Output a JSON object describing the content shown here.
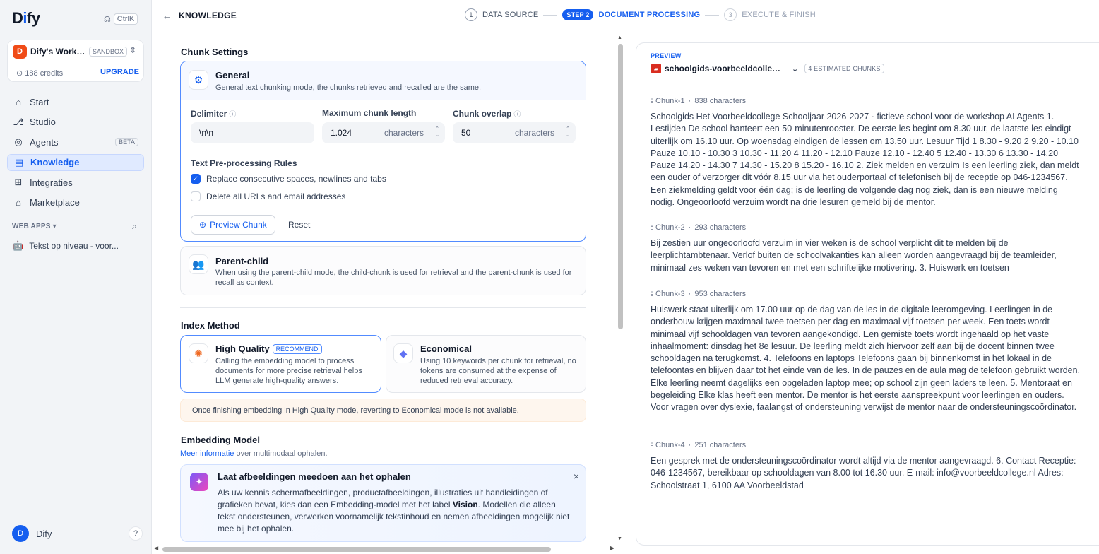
{
  "sidebar": {
    "logo": "Dify",
    "shortcut": "CtrlK",
    "workspace": {
      "avatar": "D",
      "name": "Dify's Works...",
      "badge": "SANDBOX",
      "credits": "188 credits",
      "upgrade": "UPGRADE"
    },
    "nav": [
      {
        "label": "Start",
        "icon": "home-icon"
      },
      {
        "label": "Studio",
        "icon": "studio-icon"
      },
      {
        "label": "Agents",
        "icon": "agents-icon",
        "badge": "BETA"
      },
      {
        "label": "Knowledge",
        "icon": "knowledge-icon",
        "active": true
      },
      {
        "label": "Integraties",
        "icon": "integrations-icon"
      },
      {
        "label": "Marketplace",
        "icon": "marketplace-icon"
      }
    ],
    "web_apps_label": "WEB APPS",
    "app_item": {
      "emoji": "🤖",
      "label": "Tekst op niveau - voor..."
    },
    "user": {
      "avatar": "D",
      "name": "Dify"
    },
    "help": "?"
  },
  "topbar": {
    "title": "KNOWLEDGE",
    "steps": [
      {
        "num": "1",
        "label": "DATA SOURCE",
        "state": "done"
      },
      {
        "num": "STEP 2",
        "label": "DOCUMENT PROCESSING",
        "state": "active"
      },
      {
        "num": "3",
        "label": "EXECUTE & FINISH",
        "state": "disabled"
      }
    ]
  },
  "chunk_settings": {
    "title": "Chunk Settings",
    "general": {
      "title": "General",
      "desc": "General text chunking mode, the chunks retrieved and recalled are the same.",
      "delimiter_label": "Delimiter",
      "delimiter_value": "\\n\\n",
      "max_len_label": "Maximum chunk length",
      "max_len_value": "1.024",
      "overlap_label": "Chunk overlap",
      "overlap_value": "50",
      "unit": "characters",
      "rules_title": "Text Pre-processing Rules",
      "rule1": "Replace consecutive spaces, newlines and tabs",
      "rule2": "Delete all URLs and email addresses",
      "preview_btn": "Preview Chunk",
      "reset_btn": "Reset"
    },
    "parent_child": {
      "title": "Parent-child",
      "desc": "When using the parent-child mode, the child-chunk is used for retrieval and the parent-chunk is used for recall as context."
    }
  },
  "index_method": {
    "title": "Index Method",
    "hq_title": "High Quality",
    "hq_badge": "RECOMMEND",
    "hq_desc": "Calling the embedding model to process documents for more precise retrieval helps LLM generate high-quality answers.",
    "eco_title": "Economical",
    "eco_desc": "Using 10 keywords per chunk for retrieval, no tokens are consumed at the expense of reduced retrieval accuracy.",
    "warning": "Once finishing embedding in High Quality mode, reverting to Economical mode is not available."
  },
  "embedding": {
    "title": "Embedding Model",
    "link": "Meer informatie",
    "link_suffix": " over multimodaal ophalen.",
    "tip_title": "Laat afbeeldingen meedoen aan het ophalen",
    "tip_body_1": "Als uw kennis schermafbeeldingen, productafbeeldingen, illustraties uit handleidingen of grafieken bevat, kies dan een Embedding-model met het label ",
    "tip_body_bold": "Vision",
    "tip_body_2": ". Modellen die alleen tekst ondersteunen, verwerken voornamelijk tekstinhoud en nemen afbeeldingen mogelijk niet mee bij het ophalen."
  },
  "preview": {
    "label": "PREVIEW",
    "file_name": "schoolgids-voorbeeldcollege.pdf",
    "estimated": "4 ESTIMATED CHUNKS",
    "chunks": [
      {
        "name": "Chunk-1",
        "chars": "838 characters",
        "text": "Schoolgids Het Voorbeeldcollege Schooljaar 2026-2027 · fictieve school voor de workshop AI Agents 1. Lestijden De school hanteert een 50-minutenrooster. De eerste les begint om 8.30 uur, de laatste les eindigt uiterlijk om 16.10 uur. Op woensdag eindigen de lessen om 13.50 uur. Lesuur Tijd 1 8.30 - 9.20 2 9.20 - 10.10 Pauze 10.10 - 10.30 3 10.30 - 11.20 4 11.20 - 12.10 Pauze 12.10 - 12.40 5 12.40 - 13.30 6 13.30 - 14.20 Pauze 14.20 - 14.30 7 14.30 - 15.20 8 15.20 - 16.10 2. Ziek melden en verzuim Is een leerling ziek, dan meldt een ouder of verzorger dit vóór 8.15 uur via het ouderportaal of telefonisch bij de receptie op 046-1234567. Een ziekmelding geldt voor één dag; is de leerling de volgende dag nog ziek, dan is een nieuwe melding nodig. Ongeoorloofd verzuim wordt na drie lesuren gemeld bij de mentor."
      },
      {
        "name": "Chunk-2",
        "chars": "293 characters",
        "text": "Bij zestien uur ongeoorloofd verzuim in vier weken is de school verplicht dit te melden bij de leerplichtambtenaar. Verlof buiten de schoolvakanties kan alleen worden aangevraagd bij de teamleider, minimaal zes weken van tevoren en met een schriftelijke motivering. 3. Huiswerk en toetsen"
      },
      {
        "name": "Chunk-3",
        "chars": "953 characters",
        "text": "Huiswerk staat uiterlijk om 17.00 uur op de dag van de les in de digitale leeromgeving. Leerlingen in de onderbouw krijgen maximaal twee toetsen per dag en maximaal vijf toetsen per week. Een toets wordt minimaal vijf schooldagen van tevoren aangekondigd. Een gemiste toets wordt ingehaald op het vaste inhaalmoment: dinsdag het 8e lesuur. De leerling meldt zich hiervoor zelf aan bij de docent binnen twee schooldagen na terugkomst. 4. Telefoons en laptops Telefoons gaan bij binnenkomst in het lokaal in de telefoontas en blijven daar tot het einde van de les. In de pauzes en de aula mag de telefoon gebruikt worden. Elke leerling neemt dagelijks een opgeladen laptop mee; op school zijn geen laders te leen. 5. Mentoraat en begeleiding Elke klas heeft een mentor. De mentor is het eerste aanspreekpunt voor leerlingen en ouders. Voor vragen over dyslexie, faalangst of ondersteuning verwijst de mentor naar de ondersteuningscoördinator."
      },
      {
        "name": "Chunk-4",
        "chars": "251 characters",
        "text": "Een gesprek met de ondersteuningscoördinator wordt altijd via de mentor aangevraagd. 6. Contact Receptie: 046-1234567, bereikbaar op schooldagen van 8.00 tot 16.30 uur. E-mail: info@voorbeeldcollege.nl Adres: Schoolstraat 1, 6100 AA Voorbeeldstad"
      }
    ]
  },
  "colors": {
    "primary": "#155eef",
    "warning_bg": "#fef6ee",
    "sidebar_bg": "#f2f4f7"
  }
}
